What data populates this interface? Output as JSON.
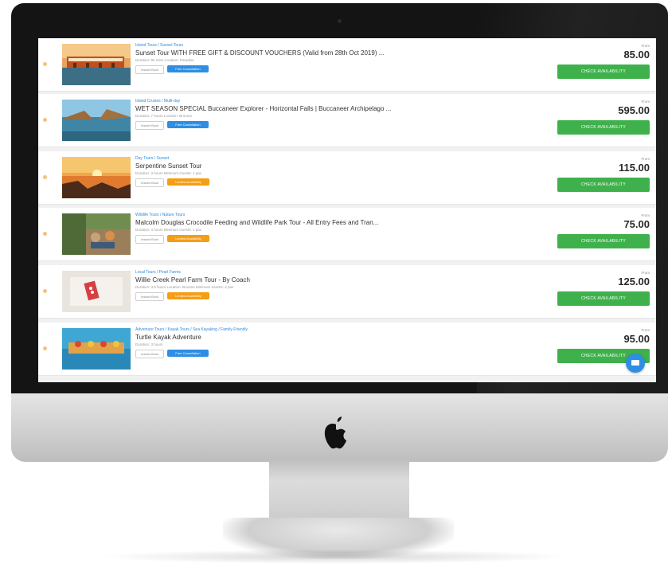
{
  "listings": [
    {
      "category": "Island Tours / Sunset Tours",
      "title": "Sunset Tour WITH FREE GIFT & DISCOUNT VOUCHERS (Valid from 28th Oct 2019) ...",
      "meta": "Duration: 90 mins        Location: Paradise",
      "chip": "Instant Book",
      "tag": "Free Cancellation",
      "tag_color": "blue",
      "from_label": "From",
      "price": "85.00",
      "button": "CHECK AVAILABILITY"
    },
    {
      "category": "Island Cruises / Multi-day",
      "title": "WET SEASON SPECIAL Buccaneer Explorer - Horizontal Falls | Buccaneer Archipelago ...",
      "meta": "Duration: 7 hours        Location: Broome",
      "chip": "Instant Book",
      "tag": "Free Cancellation",
      "tag_color": "blue",
      "from_label": "From",
      "price": "595.00",
      "button": "CHECK AVAILABILITY"
    },
    {
      "category": "Day Tours / Sunset",
      "title": "Serpentine Sunset Tour",
      "meta": "Duration: 3 hours        Minimum Guests: 1 pax",
      "chip": "Instant Book",
      "tag": "Limited Availability",
      "tag_color": "orange",
      "from_label": "From",
      "price": "115.00",
      "button": "CHECK AVAILABILITY"
    },
    {
      "category": "Wildlife Tours / Nature Tours",
      "title": "Malcolm Douglas Crocodile Feeding and Wildlife Park Tour - All Entry Fees and Tran...",
      "meta": "Duration: 4 hours        Minimum Guests: 1 pax",
      "chip": "Instant Book",
      "tag": "Limited Availability",
      "tag_color": "orange",
      "from_label": "From",
      "price": "75.00",
      "button": "CHECK AVAILABILITY"
    },
    {
      "category": "Local Tours / Pearl Farms",
      "title": "Willie Creek Pearl Farm Tour - By Coach",
      "meta": "Duration: 3.5 hours        Location: Broome        Minimum Guests: 2 pax",
      "chip": "Instant Book",
      "tag": "Limited Availability",
      "tag_color": "orange",
      "from_label": "From",
      "price": "125.00",
      "button": "CHECK AVAILABILITY"
    },
    {
      "category": "Adventure Tours / Kayak Tours / Sea Kayaking / Family Friendly",
      "title": "Turtle Kayak Adventure",
      "meta": "Duration: 3 hours",
      "chip": "Instant Book",
      "tag": "Free Cancellation",
      "tag_color": "blue",
      "from_label": "From",
      "price": "95.00",
      "button": "CHECK AVAILABILITY"
    }
  ],
  "colors": {
    "accent_green": "#3fb14c",
    "accent_blue": "#2e8ee3",
    "accent_orange": "#f59d14",
    "category_link": "#2a8be0"
  },
  "chat": {
    "icon": "chat-icon"
  }
}
